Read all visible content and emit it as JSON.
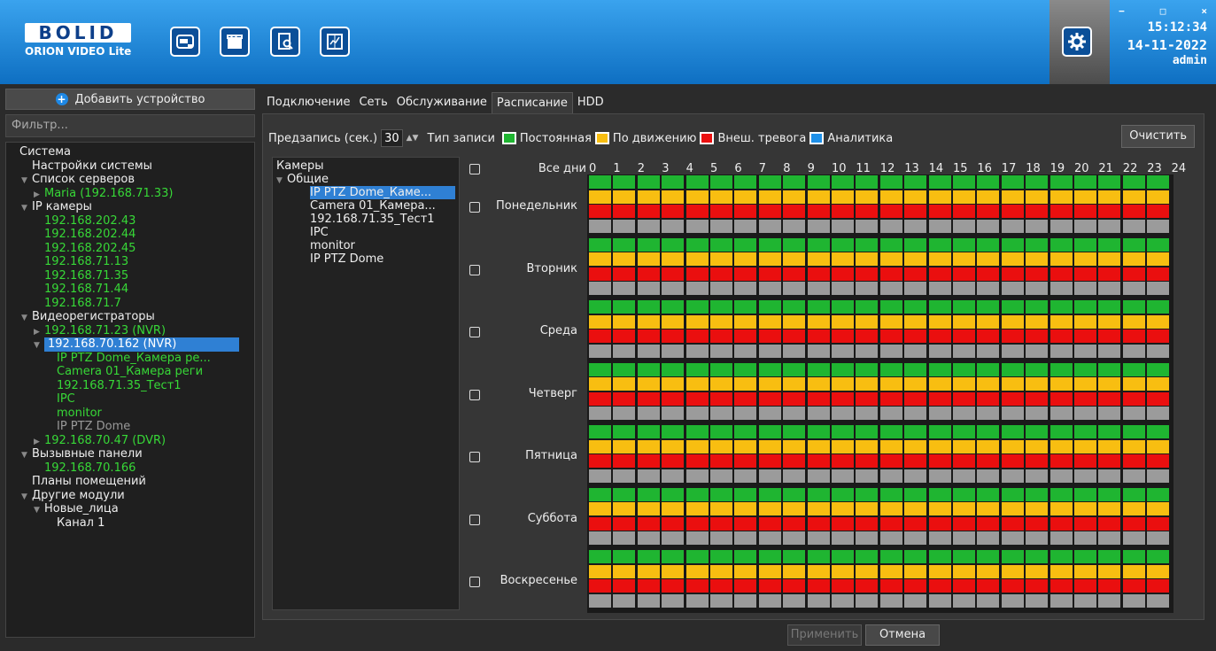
{
  "header": {
    "logo_text": "BOLID",
    "logo_sub": "ORION VIDEO Lite",
    "toolbar_icons": [
      "camera-icon",
      "clapper-icon",
      "document-search-icon",
      "chart-icon"
    ],
    "time": "15:12:34",
    "date": "14-11-2022",
    "user": "admin"
  },
  "left": {
    "add_device": "Добавить устройство",
    "filter_placeholder": "Фильтр...",
    "tree": [
      {
        "text": "Система",
        "indent": 0,
        "color": "w",
        "arrow": ""
      },
      {
        "text": "Настройки системы",
        "indent": 1,
        "color": "w",
        "arrow": ""
      },
      {
        "text": "Список серверов",
        "indent": 1,
        "color": "w",
        "arrow": "▼"
      },
      {
        "text": "Maria (192.168.71.33)",
        "indent": 2,
        "color": "g",
        "arrow": "▶"
      },
      {
        "text": "IP камеры",
        "indent": 1,
        "color": "w",
        "arrow": "▼"
      },
      {
        "text": "192.168.202.43",
        "indent": 2,
        "color": "g",
        "arrow": ""
      },
      {
        "text": "192.168.202.44",
        "indent": 2,
        "color": "g",
        "arrow": ""
      },
      {
        "text": "192.168.202.45",
        "indent": 2,
        "color": "g",
        "arrow": ""
      },
      {
        "text": "192.168.71.13",
        "indent": 2,
        "color": "g",
        "arrow": ""
      },
      {
        "text": "192.168.71.35",
        "indent": 2,
        "color": "g",
        "arrow": ""
      },
      {
        "text": "192.168.71.44",
        "indent": 2,
        "color": "g",
        "arrow": ""
      },
      {
        "text": "192.168.71.7",
        "indent": 2,
        "color": "g",
        "arrow": ""
      },
      {
        "text": "Видеорегистраторы",
        "indent": 1,
        "color": "w",
        "arrow": "▼"
      },
      {
        "text": "192.168.71.23 (NVR)",
        "indent": 2,
        "color": "g",
        "arrow": "▶"
      },
      {
        "text": "192.168.70.162 (NVR)",
        "indent": 2,
        "color": "sel",
        "arrow": "▼"
      },
      {
        "text": "IP PTZ Dome_Камера ре...",
        "indent": 3,
        "color": "g",
        "arrow": ""
      },
      {
        "text": "Camera 01_Камера реги",
        "indent": 3,
        "color": "g",
        "arrow": ""
      },
      {
        "text": "192.168.71.35_Тест1",
        "indent": 3,
        "color": "g",
        "arrow": ""
      },
      {
        "text": "IPC",
        "indent": 3,
        "color": "g",
        "arrow": ""
      },
      {
        "text": "monitor",
        "indent": 3,
        "color": "g",
        "arrow": ""
      },
      {
        "text": "IP PTZ Dome",
        "indent": 3,
        "color": "gr",
        "arrow": ""
      },
      {
        "text": "192.168.70.47 (DVR)",
        "indent": 2,
        "color": "g",
        "arrow": "▶"
      },
      {
        "text": "Вызывные панели",
        "indent": 1,
        "color": "w",
        "arrow": "▼"
      },
      {
        "text": "192.168.70.166",
        "indent": 2,
        "color": "g",
        "arrow": ""
      },
      {
        "text": "Планы помещений",
        "indent": 1,
        "color": "w",
        "arrow": ""
      },
      {
        "text": "Другие модули",
        "indent": 1,
        "color": "w",
        "arrow": "▼"
      },
      {
        "text": "Новые_лица",
        "indent": 2,
        "color": "w",
        "arrow": "▼"
      },
      {
        "text": "Канал 1",
        "indent": 3,
        "color": "w",
        "arrow": ""
      }
    ]
  },
  "tabs": [
    "Подключение",
    "Сеть",
    "Обслуживание",
    "Расписание",
    "HDD"
  ],
  "active_tab": "Расписание",
  "schedule": {
    "prerecord_label": "Предзапись (сек.)",
    "prerecord_value": "30",
    "record_type_label": "Тип записи",
    "legend": [
      {
        "label": "Постоянная",
        "color": "#1fb531"
      },
      {
        "label": "По движению",
        "color": "#f8be11"
      },
      {
        "label": "Внеш. тревога",
        "color": "#ea0f0f"
      },
      {
        "label": "Аналитика",
        "color": "#1e90e8"
      }
    ],
    "clear": "Очистить",
    "cameras_header": "Камеры",
    "cameras_group": "Общие",
    "cameras": [
      "IP PTZ Dome_Каме...",
      "Camera 01_Камера...",
      "192.168.71.35_Тест1",
      "IPC",
      "monitor",
      "IP PTZ Dome"
    ],
    "all_days": "Все дни",
    "days": [
      "Понедельник",
      "Вторник",
      "Среда",
      "Четверг",
      "Пятница",
      "Суббота",
      "Воскресенье"
    ],
    "hours": [
      "0",
      "1",
      "2",
      "3",
      "4",
      "5",
      "6",
      "7",
      "8",
      "9",
      "10",
      "11",
      "12",
      "13",
      "14",
      "15",
      "16",
      "17",
      "18",
      "19",
      "20",
      "21",
      "22",
      "23",
      "24"
    ]
  },
  "footer": {
    "apply": "Применить",
    "cancel": "Отмена"
  }
}
